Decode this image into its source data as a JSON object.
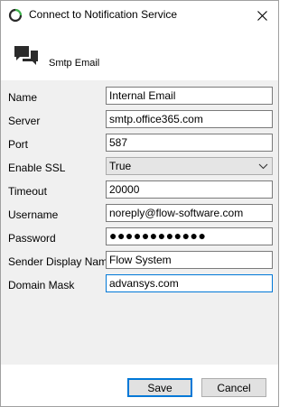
{
  "window": {
    "title": "Connect to Notification Service",
    "icon": "refresh-circle-icon",
    "accent_color": "#0078d7"
  },
  "header": {
    "icon": "chat-bubbles-icon",
    "service_name": "Smtp Email"
  },
  "form": {
    "name": {
      "label": "Name",
      "value": "Internal Email"
    },
    "server": {
      "label": "Server",
      "value": "smtp.office365.com"
    },
    "port": {
      "label": "Port",
      "value": "587"
    },
    "enable_ssl": {
      "label": "Enable SSL",
      "value": "True"
    },
    "timeout": {
      "label": "Timeout",
      "value": "20000"
    },
    "username": {
      "label": "Username",
      "value": "noreply@flow-software.com"
    },
    "password": {
      "label": "Password",
      "value": "●●●●●●●●●●●●"
    },
    "sender_display_name": {
      "label": "Sender Display Name",
      "value": "Flow System"
    },
    "domain_mask": {
      "label": "Domain Mask",
      "value": "advansys.com"
    }
  },
  "buttons": {
    "save": "Save",
    "cancel": "Cancel"
  }
}
